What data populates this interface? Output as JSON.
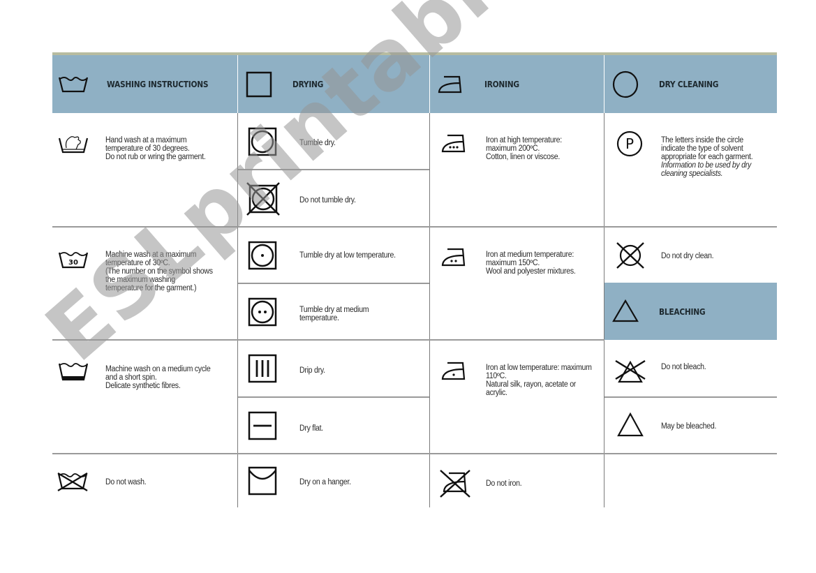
{
  "headers": {
    "washing": {
      "label": "WASHING INSTRUCTIONS",
      "icon": "washtub-icon"
    },
    "drying": {
      "label": "DRYING",
      "icon": "square-icon"
    },
    "ironing": {
      "label": "IRONING",
      "icon": "iron-icon"
    },
    "dry_cleaning": {
      "label": "DRY CLEANING",
      "icon": "circle-icon"
    },
    "bleaching": {
      "label": "BLEACHING",
      "icon": "triangle-icon"
    }
  },
  "washing": [
    {
      "icon": "hand-wash-icon",
      "lines": [
        "Hand wash at a maximum",
        "temperature of 30 degrees.",
        "Do not rub or wring the garment."
      ]
    },
    {
      "icon": "machine-wash-30-icon",
      "badge": "30",
      "lines": [
        "Machine wash at a maximum",
        "temperature of 30ºC.",
        "(The number on the symbol shows",
        "the maximum washing",
        "temperature for the garment.)"
      ]
    },
    {
      "icon": "delicate-wash-icon",
      "lines": [
        "Machine wash on a medium cycle",
        "and a short spin.",
        "Delicate synthetic fibres."
      ]
    },
    {
      "icon": "do-not-wash-icon",
      "lines": [
        "Do not wash."
      ]
    }
  ],
  "drying": [
    {
      "icon": "tumble-dry-icon",
      "lines": [
        "Tumble dry."
      ]
    },
    {
      "icon": "do-not-tumble-dry-icon",
      "lines": [
        "Do not tumble dry."
      ]
    },
    {
      "icon": "tumble-dry-low-icon",
      "lines": [
        "Tumble dry at low temperature."
      ]
    },
    {
      "icon": "tumble-dry-medium-icon",
      "lines": [
        "Tumble dry at medium",
        "temperature."
      ]
    },
    {
      "icon": "drip-dry-icon",
      "lines": [
        "Drip dry."
      ]
    },
    {
      "icon": "dry-flat-icon",
      "lines": [
        "Dry flat."
      ]
    },
    {
      "icon": "dry-on-hanger-icon",
      "lines": [
        "Dry on a hanger."
      ]
    }
  ],
  "ironing": [
    {
      "icon": "iron-high-icon",
      "lines": [
        "Iron at high temperature:",
        "maximum 200ºC.",
        "Cotton, linen or viscose."
      ]
    },
    {
      "icon": "iron-medium-icon",
      "lines": [
        "Iron at medium temperature:",
        "maximum 150ºC.",
        "Wool and polyester mixtures."
      ]
    },
    {
      "icon": "iron-low-icon",
      "lines": [
        "Iron at low temperature: maximum",
        "110ºC.",
        "Natural silk, rayon, acetate or",
        "acrylic."
      ]
    },
    {
      "icon": "do-not-iron-icon",
      "lines": [
        "Do not iron."
      ]
    }
  ],
  "dry_cleaning": [
    {
      "icon": "dry-clean-p-icon",
      "badge": "P",
      "lines": [
        "The letters inside the circle",
        "indicate the type of solvent",
        "appropriate for each garment."
      ],
      "italic_lines": [
        "Information to be used by dry",
        "cleaning specialists."
      ]
    },
    {
      "icon": "do-not-dry-clean-icon",
      "lines": [
        "Do not dry clean."
      ]
    }
  ],
  "bleaching": [
    {
      "icon": "do-not-bleach-icon",
      "lines": [
        "Do not bleach."
      ]
    },
    {
      "icon": "may-bleach-icon",
      "lines": [
        "May be bleached."
      ]
    }
  ],
  "watermark": "ESLprintables.com",
  "colors": {
    "header_bg": "#8fb0c4",
    "top_line": "#b7bca0"
  }
}
